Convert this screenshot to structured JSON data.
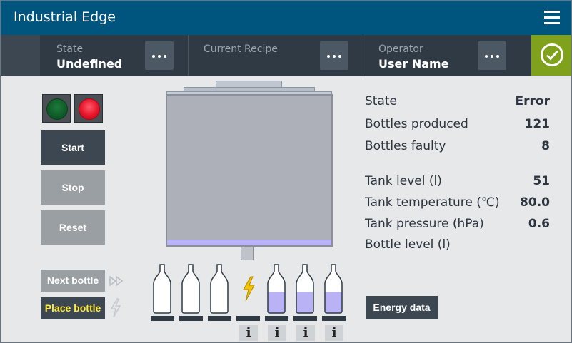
{
  "app": {
    "title": "Industrial Edge"
  },
  "header": {
    "state": {
      "label": "State",
      "value": "Undefined"
    },
    "recipe": {
      "label": "Current Recipe",
      "value": ""
    },
    "operator": {
      "label": "Operator",
      "value": "User Name"
    }
  },
  "controls": {
    "start": "Start",
    "stop": "Stop",
    "reset": "Reset",
    "next_bottle": "Next bottle",
    "place_bottle": "Place bottle",
    "lamps": {
      "green": "off",
      "red": "on"
    }
  },
  "stats": [
    {
      "label": "State",
      "value": "Error"
    },
    {
      "label": "Bottles produced",
      "value": "121"
    },
    {
      "label": "Bottles faulty",
      "value": "8"
    },
    {
      "label": "Tank level (l)",
      "value": "51"
    },
    {
      "label": "Tank temperature (℃)",
      "value": "80.0"
    },
    {
      "label": "Tank pressure (hPa)",
      "value": "0.6"
    },
    {
      "label": "Bottle level (l)",
      "value": ""
    }
  ],
  "tank": {
    "fill_fraction": 0.04
  },
  "bottles": [
    {
      "fill": 0
    },
    {
      "fill": 0
    },
    {
      "fill": 0
    },
    {
      "fault": true
    },
    {
      "fill": 0.55
    },
    {
      "fill": 0.55
    },
    {
      "fill": 0.55
    }
  ],
  "info_icon": "i",
  "energy_button": "Energy data",
  "colors": {
    "titlebar": "#00557f",
    "ok_badge": "#7fa11b",
    "liquid": "#b9b3f5",
    "fault_bolt": "#f5c400",
    "place_text": "#ffeb3b"
  }
}
